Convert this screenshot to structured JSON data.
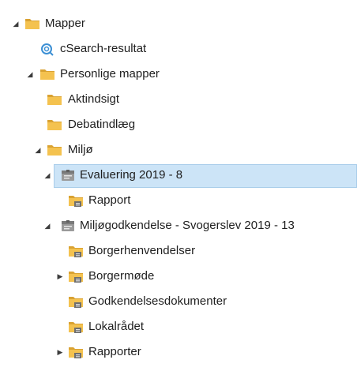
{
  "tree": {
    "nodes": [
      {
        "label": "Mapper",
        "icon": "folder-icon",
        "expander": "expanded"
      },
      {
        "label": "cSearch-resultat",
        "icon": "search-results-icon",
        "expander": "none"
      },
      {
        "label": "Personlige mapper",
        "icon": "folder-icon",
        "expander": "expanded"
      },
      {
        "label": "Aktindsigt",
        "icon": "folder-icon",
        "expander": "none"
      },
      {
        "label": "Debatindlæg",
        "icon": "folder-icon",
        "expander": "none"
      },
      {
        "label": "Miljø",
        "icon": "folder-icon",
        "expander": "expanded"
      },
      {
        "label": "Evaluering 2019 - 8",
        "icon": "case-file-icon",
        "expander": "expanded",
        "selected": true
      },
      {
        "label": "Rapport",
        "icon": "shared-folder-icon",
        "expander": "none"
      },
      {
        "label": "Miljøgodkendelse - Svogerslev 2019 - 13",
        "icon": "case-file-icon",
        "expander": "expanded"
      },
      {
        "label": "Borgerhenvendelser",
        "icon": "shared-folder-icon",
        "expander": "none"
      },
      {
        "label": "Borgermøde",
        "icon": "shared-folder-icon",
        "expander": "collapsed"
      },
      {
        "label": "Godkendelsesdokumenter",
        "icon": "shared-folder-icon",
        "expander": "none"
      },
      {
        "label": "Lokalrådet",
        "icon": "shared-folder-icon",
        "expander": "none"
      },
      {
        "label": "Rapporter",
        "icon": "shared-folder-icon",
        "expander": "collapsed"
      }
    ]
  },
  "colors": {
    "folder": "#f4c24f",
    "folder_dark": "#d9a232",
    "selection": "#cce4f7",
    "selection_border": "#a9cdea",
    "search_icon": "#3b8fd4",
    "case_icon": "#8a8a8a"
  }
}
